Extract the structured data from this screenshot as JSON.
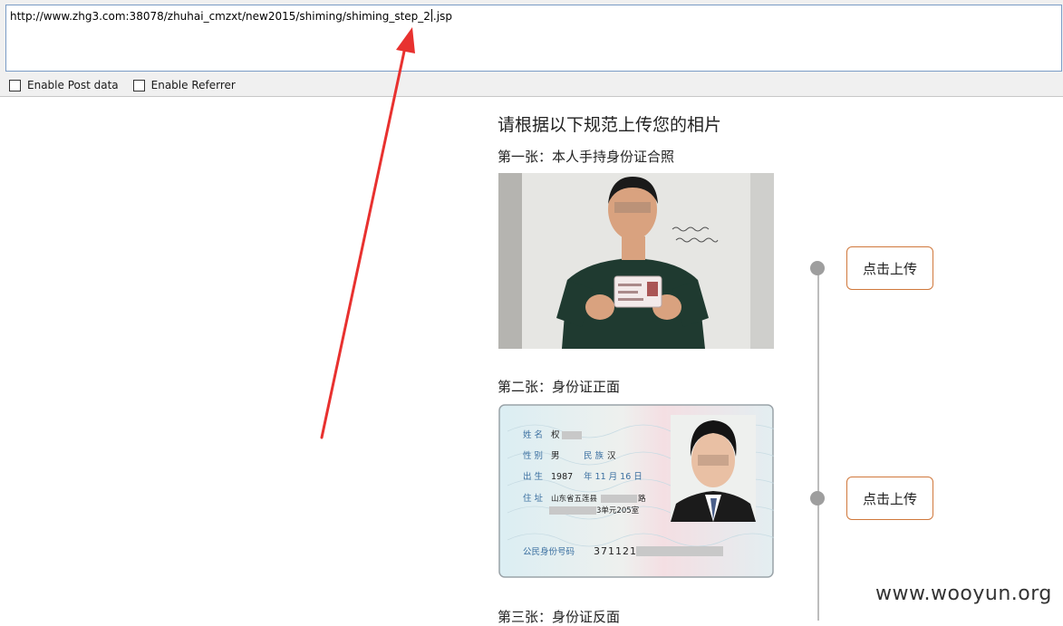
{
  "address_bar": {
    "url_before_caret": "http://www.zhg3.com:38078/zhuhai_cmzxt/new2015/shiming/shiming_step_2",
    "url_after_caret": ".jsp"
  },
  "options": {
    "post_data_label": "Enable Post data",
    "post_data_checked": false,
    "referrer_label": "Enable Referrer",
    "referrer_checked": false
  },
  "page": {
    "heading": "请根据以下规范上传您的相片",
    "steps": [
      {
        "title": "第一张：本人手持身份证合照",
        "upload_label": "点击上传"
      },
      {
        "title": "第二张：身份证正面",
        "upload_label": "点击上传"
      },
      {
        "title": "第三张：身份证反面"
      }
    ]
  },
  "id_card": {
    "name_label": "姓 名",
    "name_value": "权",
    "gender_label": "性 别",
    "gender_value": "男",
    "ethnicity_label": "民 族",
    "ethnicity_value": "汉",
    "birth_label": "出 生",
    "birth_year": "1987",
    "birth_rest": "年 11 月 16 日",
    "address_label": "住 址",
    "address_line1_start": "山东省五莲县",
    "address_line1_end": "路",
    "address_line2_end": "3单元205室",
    "id_number_label": "公民身份号码",
    "id_number_prefix": "371121"
  },
  "watermark": "www.wooyun.org",
  "colors": {
    "accent_border": "#d0783c",
    "annotation_arrow": "#e8312f",
    "timeline": "#9e9e9e"
  }
}
